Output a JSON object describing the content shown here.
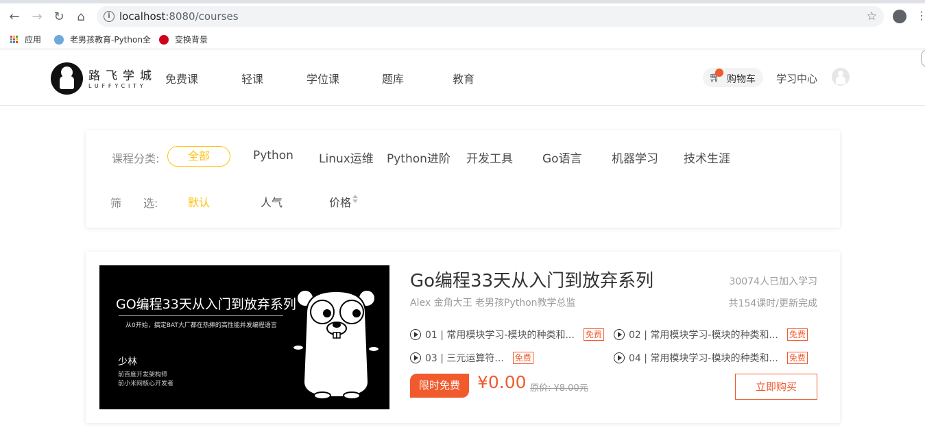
{
  "browser": {
    "url_host": "localhost",
    "url_rest": ":8080/courses",
    "bookmarks": [
      {
        "label": "应用"
      },
      {
        "label": "老男孩教育-Python全"
      },
      {
        "label": "变换背景"
      }
    ]
  },
  "header": {
    "logo_cn": "路飞学城",
    "logo_en": "LUFFYCITY",
    "nav": [
      "免费课",
      "轻课",
      "学位课",
      "题库",
      "教育"
    ],
    "cart_label": "购物车",
    "study_center": "学习中心"
  },
  "filters": {
    "category_label": "课程分类:",
    "categories": [
      "全部",
      "Python",
      "Linux运维",
      "Python进阶",
      "开发工具",
      "Go语言",
      "机器学习",
      "技术生涯"
    ],
    "active_category": "全部",
    "sort_label_1": "筛",
    "sort_label_2": "选:",
    "sorts": [
      "默认",
      "人气",
      "价格"
    ]
  },
  "course": {
    "title": "Go编程33天从入门到放弃系列",
    "teacher": "Alex 金角大王 老男孩Python教学总监",
    "learners": "30074人已加入学习",
    "status": "共154课时/更新完成",
    "cover": {
      "title": "GO编程33天从入门到放弃系列",
      "subtitle": "从0开始，搞定BAT大厂都在热捧的高性能并发编程语言",
      "teacher": "少林",
      "line1": "前百度开发架构师",
      "line2": "前小米网核心开发者"
    },
    "lessons": [
      {
        "text": "01 | 常用模块学习-模块的种类和...",
        "tag": "免费"
      },
      {
        "text": "02 | 常用模块学习-模块的种类和...",
        "tag": "免费"
      },
      {
        "text": "03 | 三元运算符...",
        "tag": "免费"
      },
      {
        "text": "04 | 常用模块学习-模块的种类和...",
        "tag": "免费"
      }
    ],
    "promo": "限时免费",
    "price": "¥0.00",
    "original_price": "原价: ¥8.00元",
    "buy_label": "立即购买"
  },
  "colors": {
    "accent": "#ffc210",
    "price": "#f05a2d"
  }
}
